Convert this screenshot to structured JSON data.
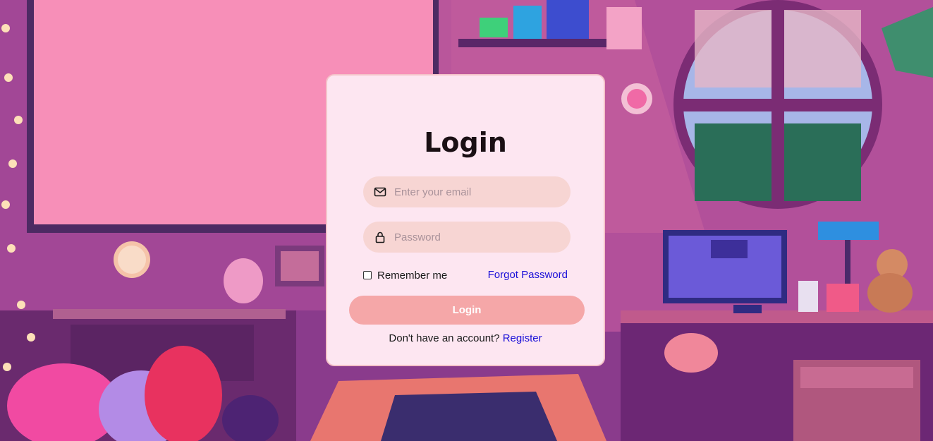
{
  "login": {
    "title": "Login",
    "email": {
      "placeholder": "Enter your email",
      "value": "",
      "icon": "envelope-icon"
    },
    "password": {
      "placeholder": "Password",
      "value": "",
      "icon": "lock-icon"
    },
    "remember_label": "Remember me",
    "remember_checked": false,
    "forgot_label": "Forgot Password",
    "submit_label": "Login",
    "signup_prompt": "Don't have an account?",
    "signup_link": "Register"
  },
  "theme": {
    "card_bg": "#fde6f1",
    "input_bg": "#f7d5d3",
    "button_bg": "#f5a7a8",
    "link_color": "#1a0fd8"
  }
}
